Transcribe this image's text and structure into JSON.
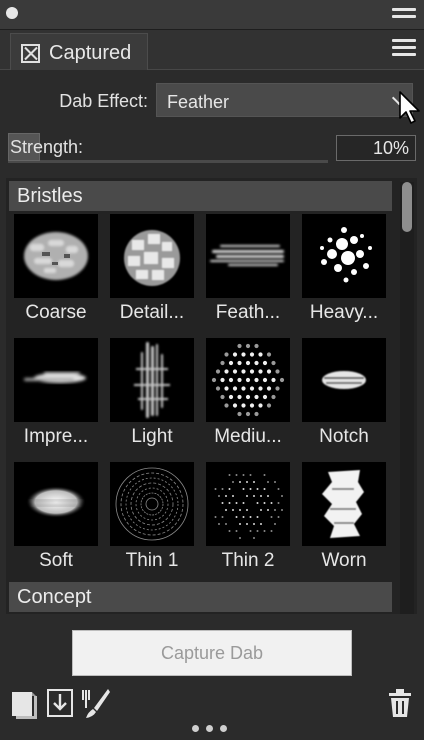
{
  "panel": {
    "tab_label": "Captured"
  },
  "dab_effect": {
    "label": "Dab Effect:",
    "value": "Feather"
  },
  "strength": {
    "label": "Strength:",
    "value_text": "10%",
    "value": 0.1
  },
  "library": {
    "sections": [
      {
        "title": "Bristles",
        "items": [
          {
            "label": "Coarse",
            "icon": "coarse-dab-icon"
          },
          {
            "label": "Detail...",
            "icon": "detail-dab-icon"
          },
          {
            "label": "Feath...",
            "icon": "feather-dab-icon"
          },
          {
            "label": "Heavy...",
            "icon": "heavy-dab-icon"
          },
          {
            "label": "Impre...",
            "icon": "impressionist-dab-icon"
          },
          {
            "label": "Light",
            "icon": "light-dab-icon"
          },
          {
            "label": "Mediu...",
            "icon": "medium-dab-icon"
          },
          {
            "label": "Notch",
            "icon": "notch-dab-icon"
          },
          {
            "label": "Soft",
            "icon": "soft-dab-icon"
          },
          {
            "label": "Thin 1",
            "icon": "thin1-dab-icon"
          },
          {
            "label": "Thin 2",
            "icon": "thin2-dab-icon"
          },
          {
            "label": "Worn",
            "icon": "worn-dab-icon"
          }
        ]
      },
      {
        "title": "Concept",
        "items": []
      }
    ]
  },
  "actions": {
    "capture_label": "Capture Dab"
  },
  "icons": {
    "window": "circle-icon",
    "menu": "hamburger-menu-icon",
    "tab_close": "close-box-icon",
    "dropdown": "chevron-down-icon",
    "pointer": "mouse-pointer-icon",
    "library_panel": "library-panel-icon",
    "import": "import-icon",
    "brush_controls": "brush-controls-icon",
    "delete": "trash-icon",
    "more": "more-dots-icon"
  },
  "colors": {
    "panel_bg": "#2b2b2b",
    "section_header": "#4a4a4a",
    "capture_button_bg": "#f1f1f1"
  }
}
